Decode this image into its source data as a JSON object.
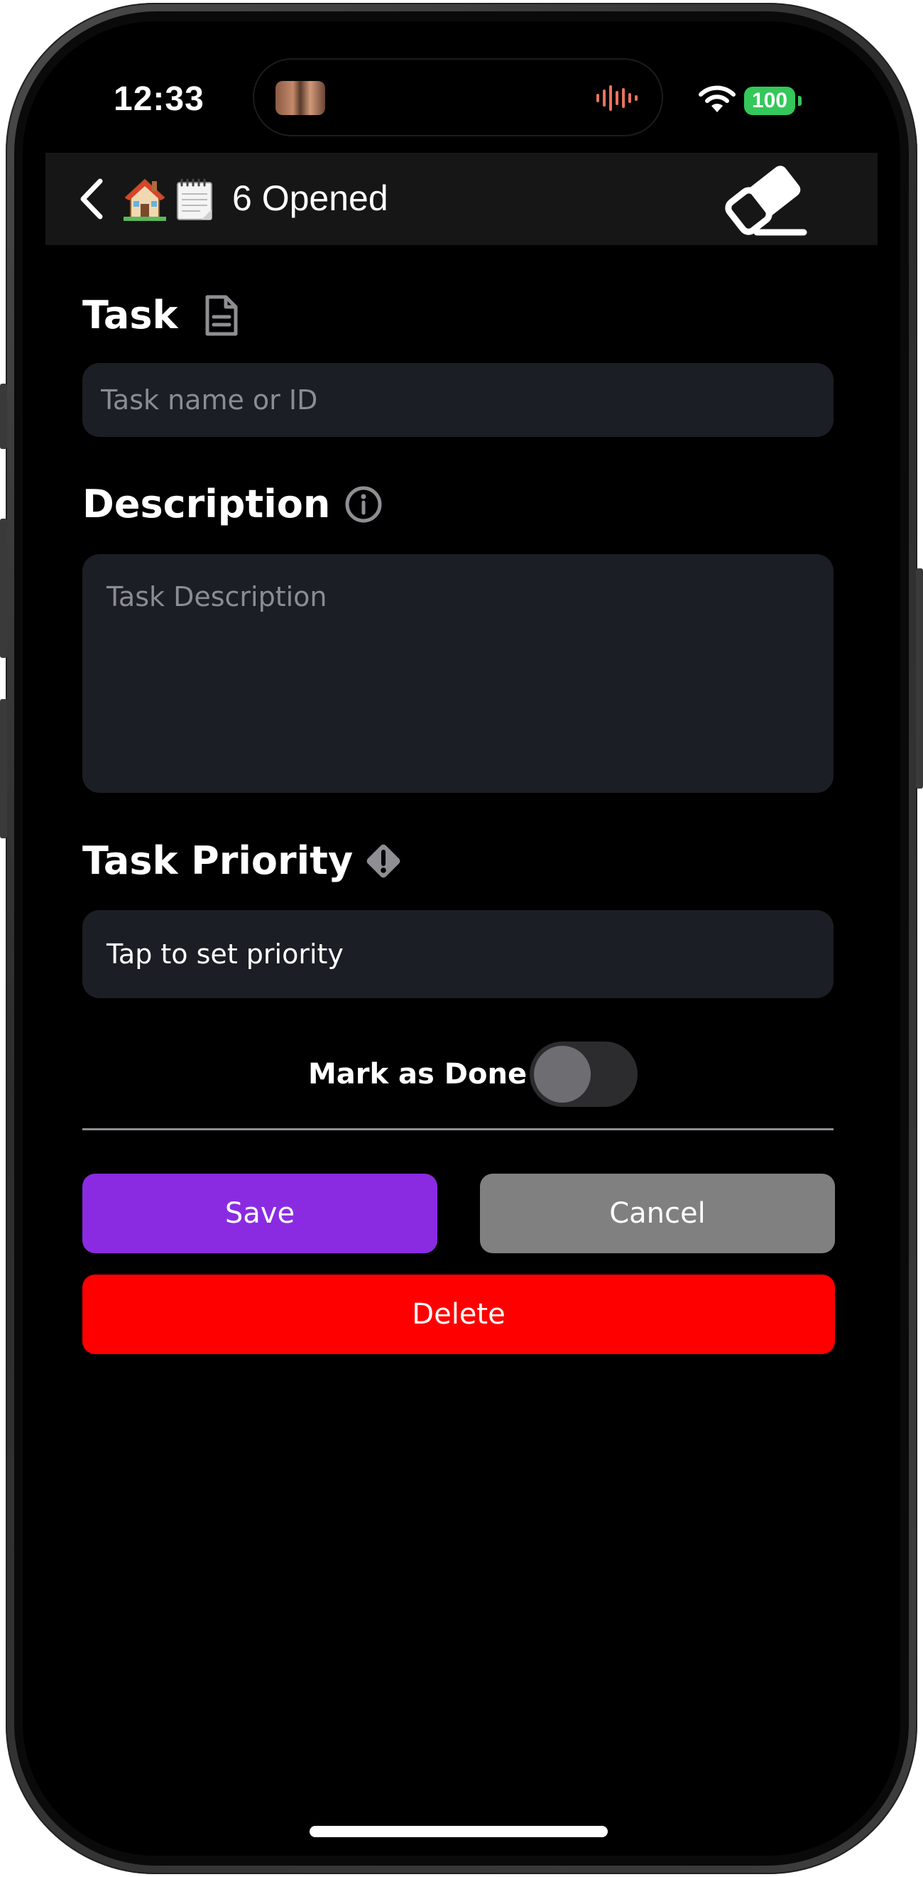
{
  "status_bar": {
    "time": "12:33",
    "battery_level": "100",
    "battery_color": "#34c759",
    "island_activity_icon": "audio-waveform-icon",
    "island_accent_color": "#e8735a"
  },
  "nav": {
    "back_icon": "chevron-left-icon",
    "emoji_house": "house-emoji-icon",
    "emoji_notepad": "notepad-emoji-icon",
    "title": "6 Opened",
    "action_icon": "eraser-icon"
  },
  "form": {
    "task_label": "Task",
    "task_label_icon": "document-icon",
    "task_placeholder": "Task name or ID",
    "task_value": "",
    "description_label": "Description",
    "description_label_icon": "info-circle-icon",
    "description_placeholder": "Task Description",
    "description_value": "",
    "priority_label": "Task Priority",
    "priority_label_icon": "diamond-exclamation-icon",
    "priority_value": "Tap to set priority",
    "done_label": "Mark as Done",
    "done_toggle_on": false
  },
  "actions": {
    "save_label": "Save",
    "cancel_label": "Cancel",
    "delete_label": "Delete"
  },
  "colors": {
    "background": "#000000",
    "navbar": "#161616",
    "field_background": "#1b1e24",
    "save": "#8a2be2",
    "cancel": "#808080",
    "delete": "#ff0000"
  }
}
